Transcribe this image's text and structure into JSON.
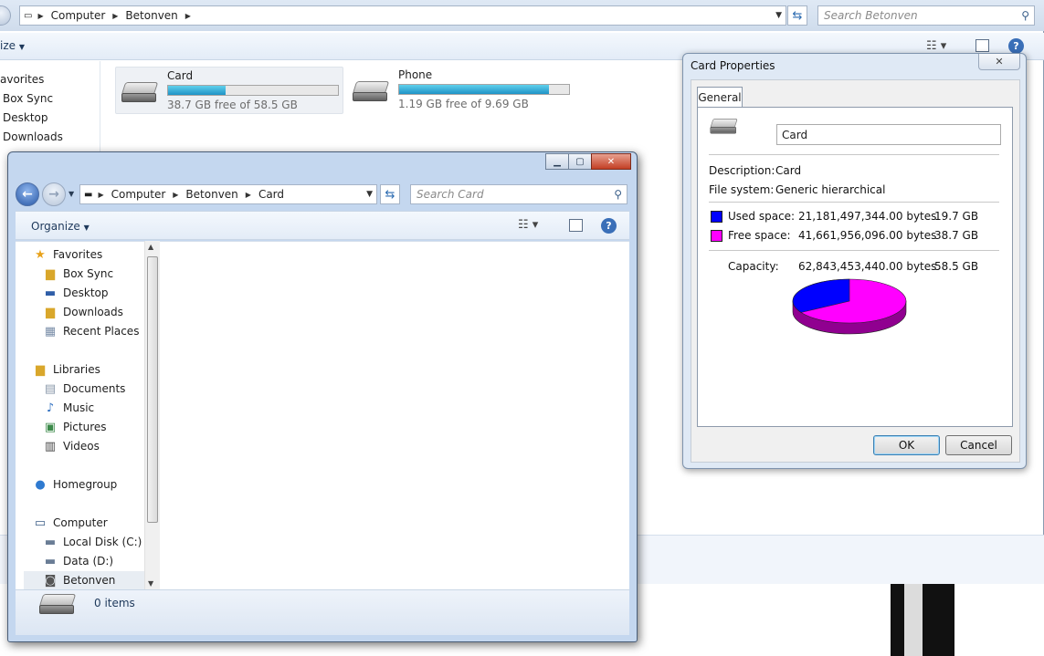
{
  "background_window": {
    "breadcrumb": [
      "Computer",
      "Betonven"
    ],
    "search_placeholder": "Search Betonven",
    "organize_label": "ize",
    "nav_items": [
      "avorites",
      "Box Sync",
      "Desktop",
      "Downloads"
    ],
    "drives": [
      {
        "name": "Card",
        "free_text": "38.7 GB free of 58.5 GB",
        "used_fraction": 0.34
      },
      {
        "name": "Phone",
        "free_text": "1.19 GB free of 9.69 GB",
        "used_fraction": 0.88
      }
    ]
  },
  "front_window": {
    "breadcrumb": [
      "Computer",
      "Betonven",
      "Card"
    ],
    "search_placeholder": "Search Card",
    "organize_label": "Organize",
    "nav": {
      "favorites": {
        "header": "Favorites",
        "items": [
          "Box Sync",
          "Desktop",
          "Downloads",
          "Recent Places"
        ]
      },
      "libraries": {
        "header": "Libraries",
        "items": [
          "Documents",
          "Music",
          "Pictures",
          "Videos"
        ]
      },
      "homegroup": "Homegroup",
      "computer": {
        "header": "Computer",
        "items": [
          "Local Disk (C:)",
          "Data (D:)",
          "Betonven"
        ]
      }
    },
    "status_text": "0 items"
  },
  "properties_dialog": {
    "title": "Card Properties",
    "tab_label": "General",
    "drive_name": "Card",
    "description_label": "Description:",
    "description_value": "Card",
    "filesystem_label": "File system:",
    "filesystem_value": "Generic hierarchical",
    "used_label": "Used space:",
    "used_bytes": "21,181,497,344.00 bytes",
    "used_size": "19.7 GB",
    "free_label": "Free space:",
    "free_bytes": "41,661,956,096.00 bytes",
    "free_size": "38.7 GB",
    "capacity_label": "Capacity:",
    "capacity_bytes": "62,843,453,440.00 bytes",
    "capacity_size": "58.5 GB",
    "used_color": "#0000ff",
    "free_color": "#ff00ff",
    "ok_label": "OK",
    "cancel_label": "Cancel"
  }
}
